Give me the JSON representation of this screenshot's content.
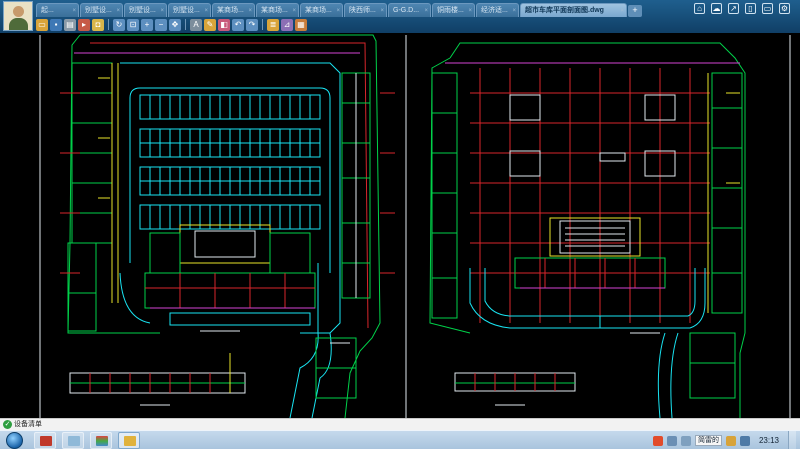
{
  "colors": {
    "cad_bg": "#000000",
    "green": "#00d24a",
    "cyan": "#19e4f2",
    "red": "#d8262b",
    "yellow": "#e8e32a",
    "magenta": "#d543d3",
    "white": "#dfe8ee",
    "blue": "#3a6cff"
  },
  "tabs": [
    {
      "label": "起..."
    },
    {
      "label": "别墅设..."
    },
    {
      "label": "别墅设..."
    },
    {
      "label": "别墅设..."
    },
    {
      "label": "某商场..."
    },
    {
      "label": "某商场..."
    },
    {
      "label": "某商场..."
    },
    {
      "label": "陕西师..."
    },
    {
      "label": "G-G.D..."
    },
    {
      "label": "铜雨楼..."
    },
    {
      "label": "经济适..."
    },
    {
      "label": "超市车库平面剖面图.dwg",
      "active": true
    }
  ],
  "new_tab_label": "+",
  "toolbar_icons": [
    "open-icon",
    "save-icon",
    "print-icon",
    "export-icon",
    "lock-icon",
    "rotate-icon",
    "zoom-window-icon",
    "zoom-in-icon",
    "zoom-out-icon",
    "pan-icon",
    "text-icon",
    "pen-icon",
    "eraser-icon",
    "undo-icon",
    "redo-icon",
    "layers-icon",
    "measure-icon",
    "properties-icon"
  ],
  "right_icons": [
    "home-icon",
    "cloud-icon",
    "share-icon",
    "phone-icon",
    "monitor-icon",
    "settings-icon"
  ],
  "status": {
    "text": "设备清单"
  },
  "taskbar": {
    "ime_label": "简雷的",
    "clock": "23:13"
  }
}
